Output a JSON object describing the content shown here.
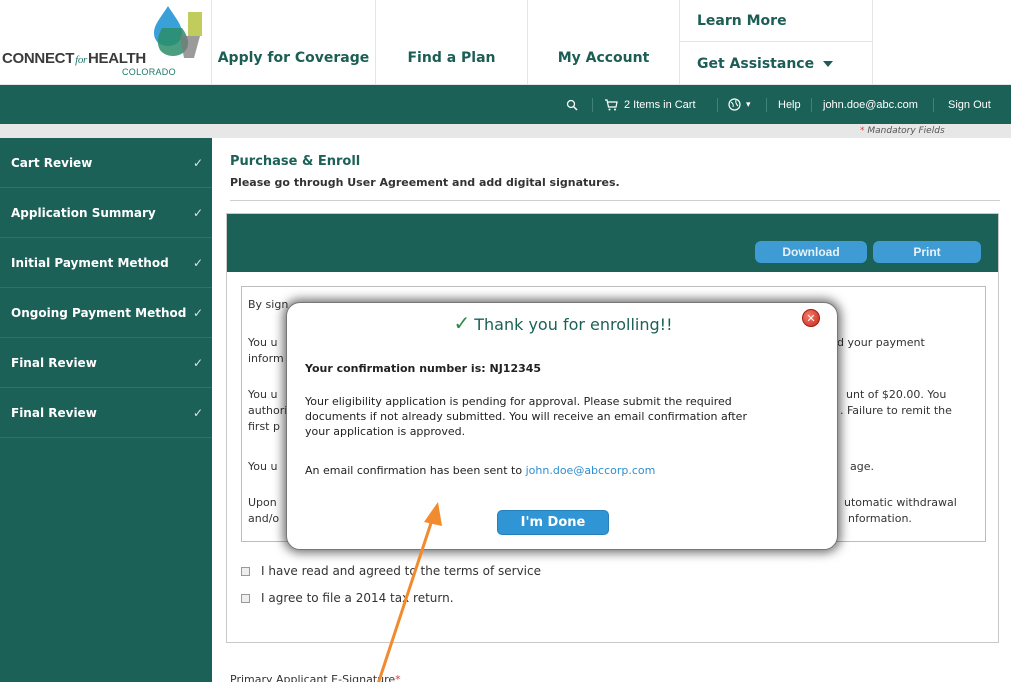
{
  "brand": {
    "logo_main_left": "CONNECT",
    "logo_for": "for",
    "logo_main_right": "HEALTH",
    "logo_sub": "COLORADO",
    "colors": {
      "primary": "#1c6157",
      "accent_blue": "#3e9bd4",
      "link": "#2e8fd0",
      "check_green": "#2e8a45",
      "required_red": "#d43d3d"
    }
  },
  "nav": {
    "apply": "Apply for Coverage",
    "find": "Find a Plan",
    "account": "My Account",
    "learn": "Learn More",
    "assist": "Get Assistance"
  },
  "utility": {
    "search_icon": "search-icon",
    "cart_text": "2 Items in Cart",
    "cart_icon": "cart-icon",
    "language_icon": "globe-icon",
    "language_caret": "▾",
    "help": "Help",
    "user_email": "john.doe@abc.com",
    "sign_out": "Sign Out"
  },
  "sidebar": {
    "items": [
      {
        "label": "Cart Review",
        "check": "✓"
      },
      {
        "label": "Application Summary",
        "check": "✓"
      },
      {
        "label": "Initial Payment Method",
        "check": "✓"
      },
      {
        "label": "Ongoing Payment Method",
        "check": "✓"
      },
      {
        "label": "Final Review",
        "check": "✓"
      },
      {
        "label": "Final Review",
        "check": "✓"
      }
    ]
  },
  "page": {
    "mandatory_star": "*",
    "mandatory": "Mandatory Fields",
    "title": "Purchase & Enroll",
    "subtitle": "Please go through User Agreement and add digital signatures.",
    "download_label": "Download",
    "print_label": "Print",
    "terms": {
      "p1_left": "By sign",
      "p2_left_a": "You u",
      "p2_left_b": "inform",
      "p2_right": "ld your payment",
      "p3_left_a": "You u",
      "p3_left_b": "authori",
      "p3_left_c": "first p",
      "p3_right_a": "unt of $20.00.  You",
      "p3_right_b": ". Failure to remit the",
      "p4_left": "You u",
      "p4_right": "age.",
      "p5_left_a": "Upon",
      "p5_left_b": "and/o",
      "p5_right_a": "utomatic withdrawal",
      "p5_right_b": "nformation."
    },
    "checkbox_tos": "I have read and agreed to the terms of service",
    "checkbox_tax": "I agree to file a 2014 tax return.",
    "esig_label": "Primary Applicant E-Signature",
    "esig_star": "*"
  },
  "modal": {
    "check": "✓",
    "title": "Thank you for enrolling!!",
    "close_glyph": "✕",
    "confirmation_label": "Your confirmation number is:",
    "confirmation_number": "NJ12345",
    "pending_line1": "Your eligibility application is pending for approval. Please submit the required",
    "pending_line2": "documents if not already submitted. You will receive an email confirmation after",
    "pending_line3": "your application is approved.",
    "email_prefix": "An email confirmation has been sent to ",
    "email": "john.doe@abccorp.com",
    "done_label": "I'm Done"
  }
}
